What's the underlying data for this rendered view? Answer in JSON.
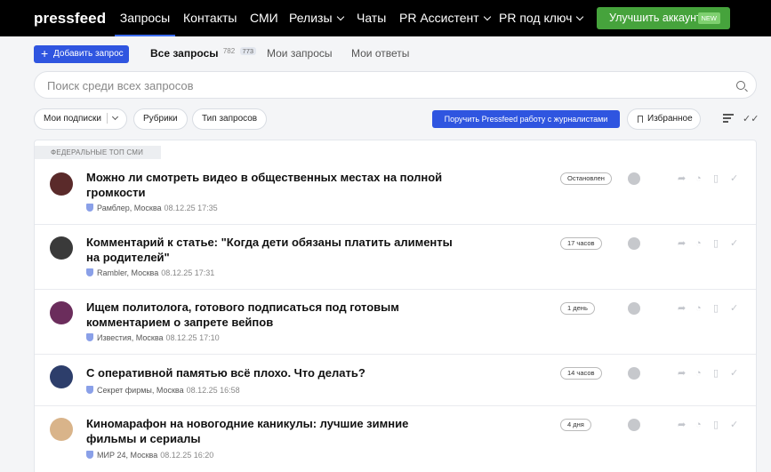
{
  "app": {
    "logo": "pressfeed"
  },
  "nav": {
    "items": [
      {
        "label": "Запросы",
        "active": true,
        "dropdown": false
      },
      {
        "label": "Контакты",
        "active": false,
        "dropdown": false
      },
      {
        "label": "СМИ",
        "active": false,
        "dropdown": false
      },
      {
        "label": "Релизы",
        "active": false,
        "dropdown": true
      },
      {
        "label": "Чаты",
        "active": false,
        "dropdown": false
      },
      {
        "label": "PR Ассистент",
        "active": false,
        "dropdown": true
      },
      {
        "label": "PR под ключ",
        "active": false,
        "dropdown": true
      }
    ],
    "upgrade_label": "Улучшить аккаунт",
    "upgrade_badge": "NEW"
  },
  "tabs": {
    "add_label": "Добавить запрос",
    "all_label": "Все запросы",
    "all_count": "782",
    "all_count_new": "773",
    "mine_label": "Мои запросы",
    "answers_label": "Мои ответы"
  },
  "search": {
    "placeholder": "Поиск среди всех запросов"
  },
  "filters": {
    "subscriptions": "Мои подписки",
    "rubrics": "Рубрики",
    "types": "Тип запросов",
    "journalists_button": "Поручить Pressfeed работу с журналистами",
    "favorites": "Избранное"
  },
  "list": {
    "section_label": "ФЕДЕРАЛЬНЫЕ ТОП СМИ",
    "rows": [
      {
        "title": "Можно ли смотреть видео в общественных местах на полной громкости",
        "source": "Рамблер, Москва",
        "date": "08.12.25 17:35",
        "status": "Остановлен",
        "avatar_color": "#5a2a2a"
      },
      {
        "title": "Комментарий к статье: \"Когда дети обязаны платить алименты на родителей\"",
        "source": "Rambler, Москва",
        "date": "08.12.25 17:31",
        "status": "17 часов",
        "avatar_color": "#3a3a3a"
      },
      {
        "title": "Ищем политолога, готового подписаться под готовым комментарием о запрете вейпов",
        "source": "Известия, Москва",
        "date": "08.12.25 17:10",
        "status": "1 день",
        "avatar_color": "#6b2d5c"
      },
      {
        "title": "С оперативной памятью всё плохо. Что делать?",
        "source": "Секрет фирмы, Москва",
        "date": "08.12.25 16:58",
        "status": "14 часов",
        "avatar_color": "#2d3e6b"
      },
      {
        "title": "Киномарафон на новогодние каникулы: лучшие зимние фильмы и сериалы",
        "source": "МИР 24, Москва",
        "date": "08.12.25 16:20",
        "status": "4 дня",
        "avatar_color": "#d9b48a"
      }
    ]
  },
  "icons": {
    "action_icons": [
      "share-icon",
      "rss-icon",
      "bookmark-icon",
      "check-icon"
    ]
  },
  "colors": {
    "accent": "#2f55e0",
    "upgrade": "#46a33c",
    "topbar": "#000000"
  }
}
